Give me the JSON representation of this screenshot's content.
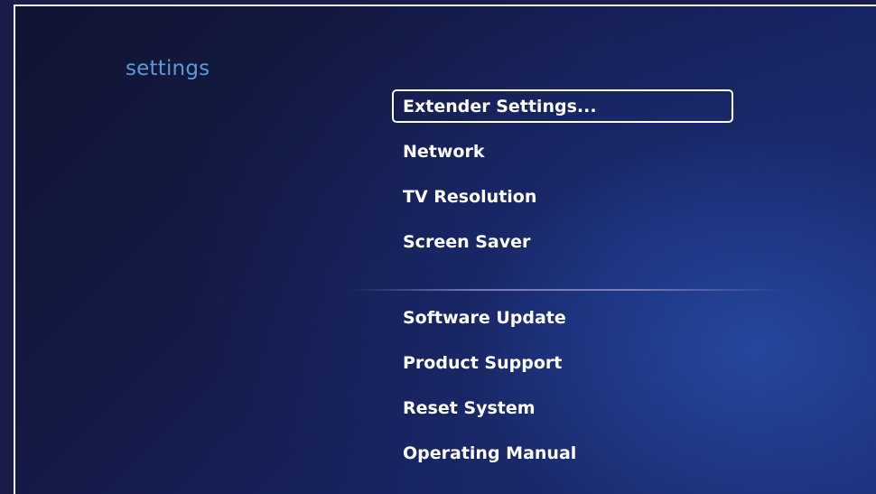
{
  "page": {
    "title": "settings"
  },
  "menu": {
    "group_top": [
      {
        "label": "Extender Settings...",
        "focused": true
      },
      {
        "label": "Network"
      },
      {
        "label": "TV Resolution"
      },
      {
        "label": "Screen Saver"
      }
    ],
    "group_bottom": [
      {
        "label": "Software Update"
      },
      {
        "label": "Product Support"
      },
      {
        "label": "Reset System"
      },
      {
        "label": "Operating Manual"
      }
    ]
  },
  "colors": {
    "title": "#5b9ad6",
    "menu_text": "#ffffff",
    "focus_border": "#ffffff",
    "background_dark": "#141a45",
    "background_glow": "#2850aa"
  }
}
